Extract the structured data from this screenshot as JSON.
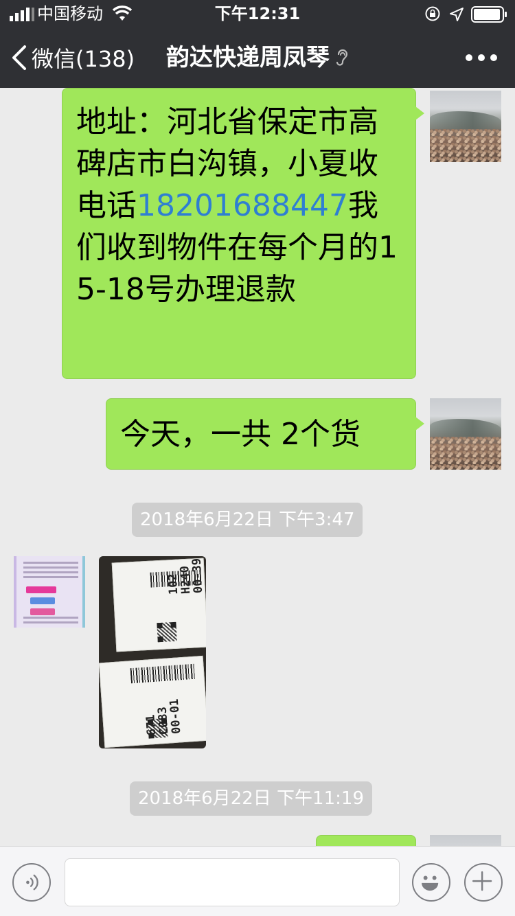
{
  "status_bar": {
    "carrier": "中国移动",
    "time": "下午12:31"
  },
  "nav": {
    "back_label": "微信(138)",
    "title": "韵达快递周凤琴"
  },
  "messages": [
    {
      "sender": "self",
      "text_before": "地址：河北省保定市高碑店市白沟镇，小夏收 电话",
      "phone": "18201688447",
      "text_after": "我们收到物件在每个月的15-18号办理退款"
    },
    {
      "sender": "self",
      "text": "今天，一共 2个货"
    }
  ],
  "timestamps": [
    "2018年6月22日 下午3:47",
    "2018年6月22日 下午11:19"
  ],
  "input": {
    "value": "",
    "placeholder": ""
  },
  "colors": {
    "header_bg": "#2f3034",
    "chat_bg": "#ebebeb",
    "bubble_self": "#a0e75a",
    "link": "#2f7fd2",
    "timestamp_bg": "#cecece"
  },
  "icons": [
    "signal-icon",
    "wifi-icon",
    "rotation-lock-icon",
    "location-arrow-icon",
    "battery-icon",
    "back-chevron-icon",
    "ear-icon",
    "more-icon",
    "voice-icon",
    "emoji-icon",
    "plus-icon"
  ]
}
